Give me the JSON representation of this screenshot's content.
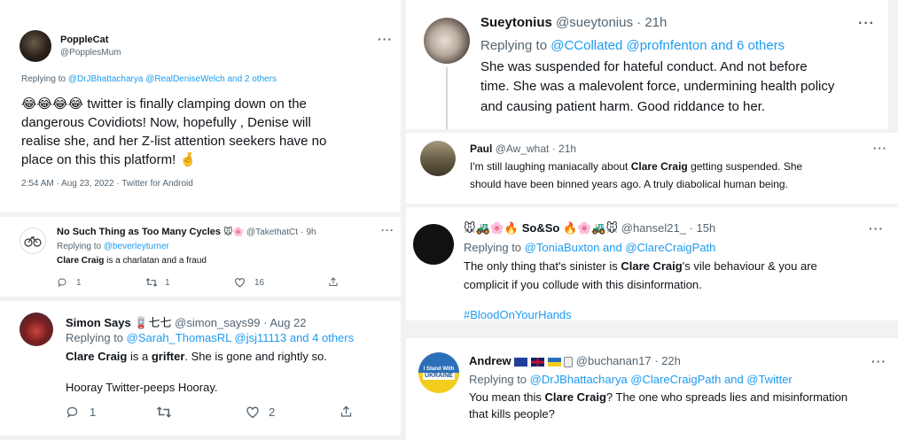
{
  "colors": {
    "accent": "#1d9bf0",
    "text": "#0f1419",
    "muted": "#536471",
    "background": "#f2f2f2"
  },
  "menu_glyph": "···",
  "tweet_popplecat": {
    "display_name": "PoppleCat",
    "handle": "@PopplesMum",
    "replying_prefix": "Replying to",
    "replying_targets": "@DrJBhattacharya @RealDeniseWelch and 2 others",
    "emoji": "😂😂😂😂",
    "line1": "twitter is finally clamping down on the",
    "line2": "dangerous Covidiots! Now, hopefully , Denise will",
    "line3": "realise she, and her Z-list attention seekers have no",
    "line4": "place on  this this platform!",
    "line4_emoji": "🤞",
    "timestamp": "2:54 AM · Aug 23, 2022 · Twitter for Android"
  },
  "tweet_cycles": {
    "display_name": "No Such Thing as Too Many Cycles",
    "name_emoji": "🐭🌸",
    "handle": "@TakethatCt",
    "time": "9h",
    "replying_prefix": "Replying to",
    "replying_targets": "@beverleyturner",
    "body_bold": "Clare Craig",
    "body_rest": " is a charlatan and a fraud",
    "retweet_count": "1",
    "reply_count": "1",
    "like_count": "16"
  },
  "tweet_simon": {
    "display_name": "Simon Says",
    "name_emoji": "🪫七七",
    "handle": "@simon_says99",
    "time": "Aug 22",
    "replying_prefix": "Replying to",
    "replying_targets": "@Sarah_ThomasRL @jsj11113 and 4 others",
    "body_bold1": "Clare Craig",
    "body_mid": " is a ",
    "body_bold2": "grifter",
    "body_rest": ". She is gone and rightly so.",
    "body_line2": "Hooray Twitter-peeps Hooray.",
    "reply_count": "1",
    "like_count": "2"
  },
  "tweet_sueytonius": {
    "display_name": "Sueytonius",
    "handle": "@sueytonius",
    "time": "21h",
    "replying_prefix": "Replying to",
    "replying_targets": "@CCollated @profnfenton and 6 others",
    "line1": "She was suspended for hateful conduct. And not before",
    "line2": "time. She was a malevolent force, undermining health policy",
    "line3": "and causing patient harm. Good riddance to her."
  },
  "tweet_paul": {
    "display_name": "Paul",
    "handle": "@Aw_what",
    "time": "21h",
    "line1_pre": "I'm still laughing maniacally about ",
    "line1_bold": "Clare Craig",
    "line1_post": " getting suspended. She",
    "line2": "should have been binned years ago. A truly diabolical human being."
  },
  "tweet_soandso": {
    "display_name": "So&So",
    "name_emoji_pre": "🐭🚜🌸🔥",
    "name_emoji_post": "🔥🌸🚜🐭",
    "handle": "@hansel21_",
    "time": "15h",
    "replying_prefix": "Replying to",
    "replying_targets": "@ToniaBuxton and @ClareCraigPath",
    "line1_pre": "The only thing that's sinister is ",
    "line1_bold": "Clare Craig",
    "line1_post": "'s vile behaviour & you are",
    "line2": "complicit if you collude with this disinformation.",
    "hashtag": "#BloodOnYourHands"
  },
  "tweet_andrew": {
    "display_name": "Andrew",
    "handle": "@buchanan17",
    "time": "22h",
    "avatar_text_1": "I Stand With",
    "avatar_text_2": "UKRAINE",
    "replying_prefix": "Replying to",
    "replying_targets": "@DrJBhattacharya @ClareCraigPath and @Twitter",
    "line1_pre": "You mean this ",
    "line1_bold": "Clare Craig",
    "line1_post": "? The one who spreads lies and misinformation",
    "line2": "that kills people?"
  }
}
